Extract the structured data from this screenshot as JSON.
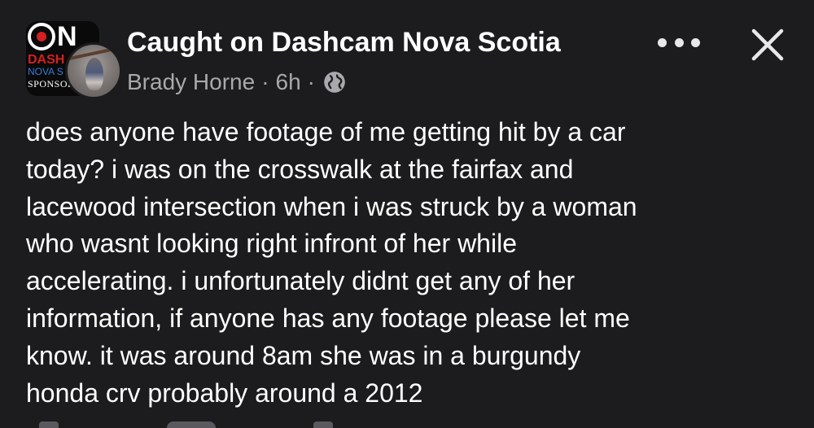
{
  "post": {
    "group_name": "Caught on Dashcam Nova Scotia",
    "author": "Brady Horne",
    "time": "6h",
    "separator": "·",
    "visibility_icon": "globe-icon",
    "logo": {
      "on_text": "ON",
      "dash_text": "DASH",
      "nova_text": "NOVA S",
      "sponsor_text": "SPONSORE"
    },
    "body_lines": [
      "does anyone have footage of me getting hit by a car",
      "today? i was on the crosswalk at the fairfax and",
      "lacewood intersection when i was struck by a woman",
      "who wasnt looking right infront of her while",
      "accelerating. i unfortunately didnt get any of her",
      "information, if anyone has any footage please let me",
      "know. it was around 8am she was in a burgundy",
      "honda crv probably around a 2012"
    ]
  },
  "actions": {
    "more_icon": "more-horizontal-icon",
    "close_icon": "close-icon"
  },
  "colors": {
    "background": "#1c1c1e",
    "text_primary": "#ffffff",
    "text_secondary": "#a8a8ad",
    "logo_red": "#d42020"
  }
}
